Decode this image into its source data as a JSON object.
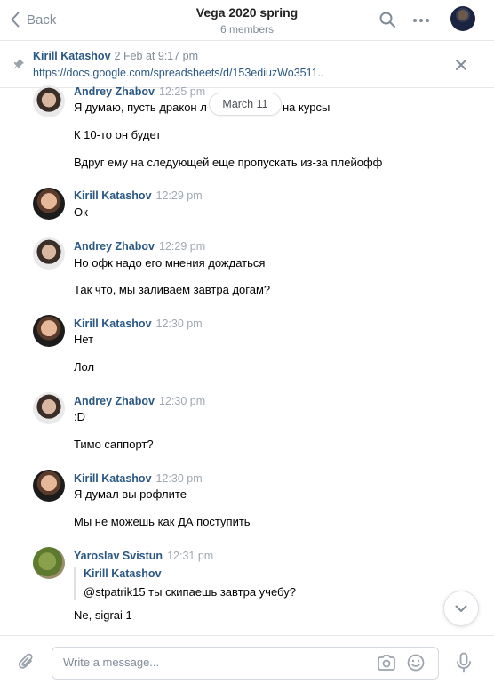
{
  "header": {
    "back_label": "Back",
    "title": "Vega 2020 spring",
    "members": "6 members"
  },
  "pinned": {
    "author": "Kirill Katashov",
    "date": "2 Feb at 9:17 pm",
    "link": "https://docs.google.com/spreadsheets/d/153ediuzWo3511.."
  },
  "date_divider": "March 11",
  "messages": [
    {
      "author": "Andrey Zhabov",
      "time": "12:25 pm",
      "lines": [
        "Я думаю, пусть дракон л",
        "на курсы",
        "К 10-то он будет",
        "Вдруг ему на следующей еще пропускать из-за плейофф"
      ]
    },
    {
      "author": "Kirill Katashov",
      "time": "12:29 pm",
      "lines": [
        "Ок"
      ]
    },
    {
      "author": "Andrey Zhabov",
      "time": "12:29 pm",
      "lines": [
        "Но офк надо его мнения дождаться",
        "Так что, мы заливаем завтра догам?"
      ]
    },
    {
      "author": "Kirill Katashov",
      "time": "12:30 pm",
      "lines": [
        "Нет",
        "Лол"
      ]
    },
    {
      "author": "Andrey Zhabov",
      "time": "12:30 pm",
      "lines": [
        ":D",
        "Тимо саппорт?"
      ]
    },
    {
      "author": "Kirill Katashov",
      "time": "12:30 pm",
      "lines": [
        "Я думал вы рофлите",
        "Мы не можешь как ДА поступить"
      ]
    },
    {
      "author": "Yaroslav Svistun",
      "time": "12:31 pm",
      "quote_author": "Kirill Katashov",
      "quote_text": "@stpatrik15 ты скипаешь завтра учебу?",
      "lines": [
        "Ne, sigrai 1"
      ]
    }
  ],
  "composer": {
    "placeholder": "Write a message..."
  },
  "colors": {
    "link_blue": "#2a5885",
    "muted_gray": "#818c99",
    "border": "#e7e8ec"
  },
  "icons": [
    "chevron-left-icon",
    "search-icon",
    "more-icon",
    "pin-icon",
    "close-icon",
    "chevron-down-icon",
    "paperclip-icon",
    "camera-icon",
    "smile-icon",
    "microphone-icon"
  ]
}
